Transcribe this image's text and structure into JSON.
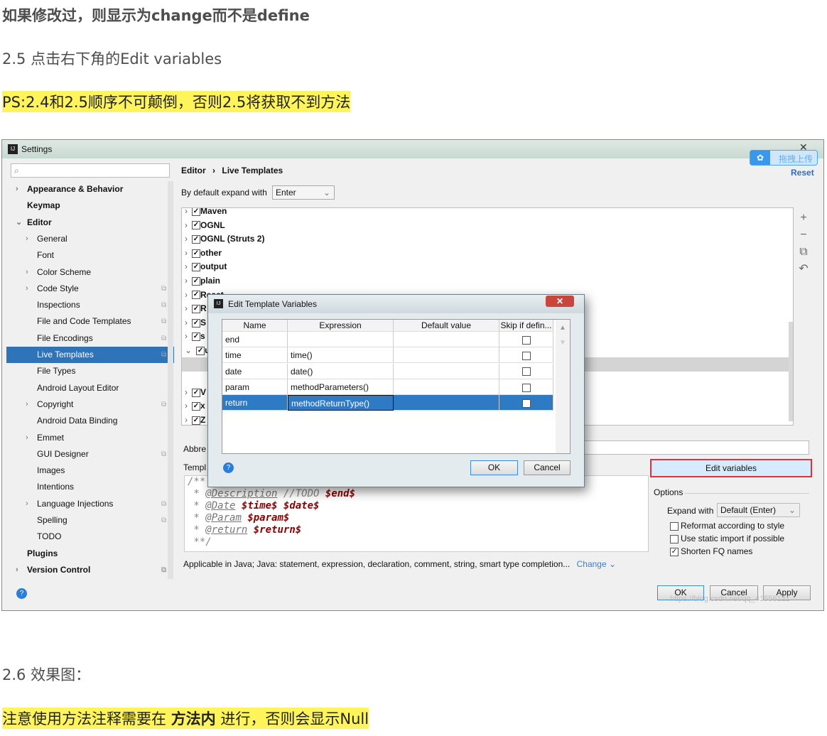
{
  "article": {
    "p1": "如果修改过，则显示为change而不是define",
    "h25": "2.5 点击右下角的Edit variables",
    "ps": "PS:2.4和2.5顺序不可颠倒，否则2.5将获取不到方法",
    "h26": "2.6 效果图：",
    "note_a": "注意使用方法注释需要在 ",
    "note_b": "方法内",
    "note_c": " 进行，否则会显示Null",
    "highlight_color": "#fff55a"
  },
  "settings": {
    "title": "Settings",
    "reset": "Reset",
    "upload_overlay": "拖拽上传",
    "breadcrumb": {
      "parent": "Editor",
      "sep": "›",
      "current": "Live Templates"
    },
    "expand_label": "By default expand with",
    "expand_value": "Enter",
    "sidebar": [
      {
        "label": "Appearance & Behavior",
        "bold": true,
        "arrow": "›",
        "level": 0
      },
      {
        "label": "Keymap",
        "bold": true,
        "level": 0
      },
      {
        "label": "Editor",
        "bold": true,
        "arrow": "⌄",
        "level": 0
      },
      {
        "label": "General",
        "arrow": "›",
        "level": 1
      },
      {
        "label": "Font",
        "level": 1
      },
      {
        "label": "Color Scheme",
        "arrow": "›",
        "level": 1
      },
      {
        "label": "Code Style",
        "arrow": "›",
        "level": 1,
        "cfg": true
      },
      {
        "label": "Inspections",
        "level": 1,
        "cfg": true
      },
      {
        "label": "File and Code Templates",
        "level": 1,
        "cfg": true
      },
      {
        "label": "File Encodings",
        "level": 1,
        "cfg": true
      },
      {
        "label": "Live Templates",
        "level": 1,
        "cfg": true,
        "selected": true
      },
      {
        "label": "File Types",
        "level": 1
      },
      {
        "label": "Android Layout Editor",
        "level": 1
      },
      {
        "label": "Copyright",
        "arrow": "›",
        "level": 1,
        "cfg": true
      },
      {
        "label": "Android Data Binding",
        "level": 1
      },
      {
        "label": "Emmet",
        "arrow": "›",
        "level": 1
      },
      {
        "label": "GUI Designer",
        "level": 1,
        "cfg": true
      },
      {
        "label": "Images",
        "level": 1
      },
      {
        "label": "Intentions",
        "level": 1
      },
      {
        "label": "Language Injections",
        "arrow": "›",
        "level": 1,
        "cfg": true
      },
      {
        "label": "Spelling",
        "level": 1,
        "cfg": true
      },
      {
        "label": "TODO",
        "level": 1
      },
      {
        "label": "Plugins",
        "bold": true,
        "level": 0
      },
      {
        "label": "Version Control",
        "bold": true,
        "arrow": "›",
        "level": 0,
        "cfg": true
      }
    ],
    "template_groups": [
      "Maven",
      "OGNL",
      "OGNL (Struts 2)",
      "other",
      "output",
      "plain",
      "React",
      "R",
      "S",
      "s",
      "u",
      "",
      "V",
      "x",
      "Z",
      "Z"
    ],
    "abbrev_label": "Abbre",
    "template_text_label": "Templ",
    "edit_variables": "Edit variables",
    "code_lines": [
      [
        {
          "t": "/** ",
          "c": ""
        }
      ],
      [
        {
          "t": " * ",
          "c": ""
        },
        {
          "t": "@Description",
          "c": "tag"
        },
        {
          "t": " //TODO ",
          "c": ""
        },
        {
          "t": "$end$",
          "c": "var"
        }
      ],
      [
        {
          "t": " * ",
          "c": ""
        },
        {
          "t": "@Date",
          "c": "tag"
        },
        {
          "t": " ",
          "c": ""
        },
        {
          "t": "$time$ $date$",
          "c": "var"
        }
      ],
      [
        {
          "t": " * ",
          "c": ""
        },
        {
          "t": "@Param",
          "c": "tag"
        },
        {
          "t": " ",
          "c": ""
        },
        {
          "t": "$param$",
          "c": "var"
        }
      ],
      [
        {
          "t": " * ",
          "c": ""
        },
        {
          "t": "@return",
          "c": "tag"
        },
        {
          "t": " ",
          "c": ""
        },
        {
          "t": "$return$",
          "c": "var"
        }
      ],
      [
        {
          "t": " **/",
          "c": ""
        }
      ]
    ],
    "options_label": "Options",
    "expand_with_label": "Expand with",
    "expand_with_value": "Default (Enter)",
    "options": [
      {
        "label": "Reformat according to style",
        "checked": false
      },
      {
        "label": "Use static import if possible",
        "checked": false
      },
      {
        "label": "Shorten FQ names",
        "checked": true
      }
    ],
    "applicable": "Applicable in Java; Java: statement, expression, declaration, comment, string, smart type completion...",
    "change_link": "Change",
    "ok": "OK",
    "cancel": "Cancel",
    "apply": "Apply",
    "watermark": "https://blog.csdn.net/qq_41556121"
  },
  "dialog": {
    "title": "Edit Template Variables",
    "columns": [
      "Name",
      "Expression",
      "Default value",
      "Skip if defin..."
    ],
    "rows": [
      {
        "name": "end",
        "expr": "",
        "def": "",
        "skip": false
      },
      {
        "name": "time",
        "expr": "time()",
        "def": "",
        "skip": false
      },
      {
        "name": "date",
        "expr": "date()",
        "def": "",
        "skip": false
      },
      {
        "name": "param",
        "expr": "methodParameters()",
        "def": "",
        "skip": false
      },
      {
        "name": "return",
        "expr": "methodReturnType()",
        "def": "",
        "skip": false,
        "selected": true
      }
    ],
    "ok": "OK",
    "cancel": "Cancel"
  }
}
